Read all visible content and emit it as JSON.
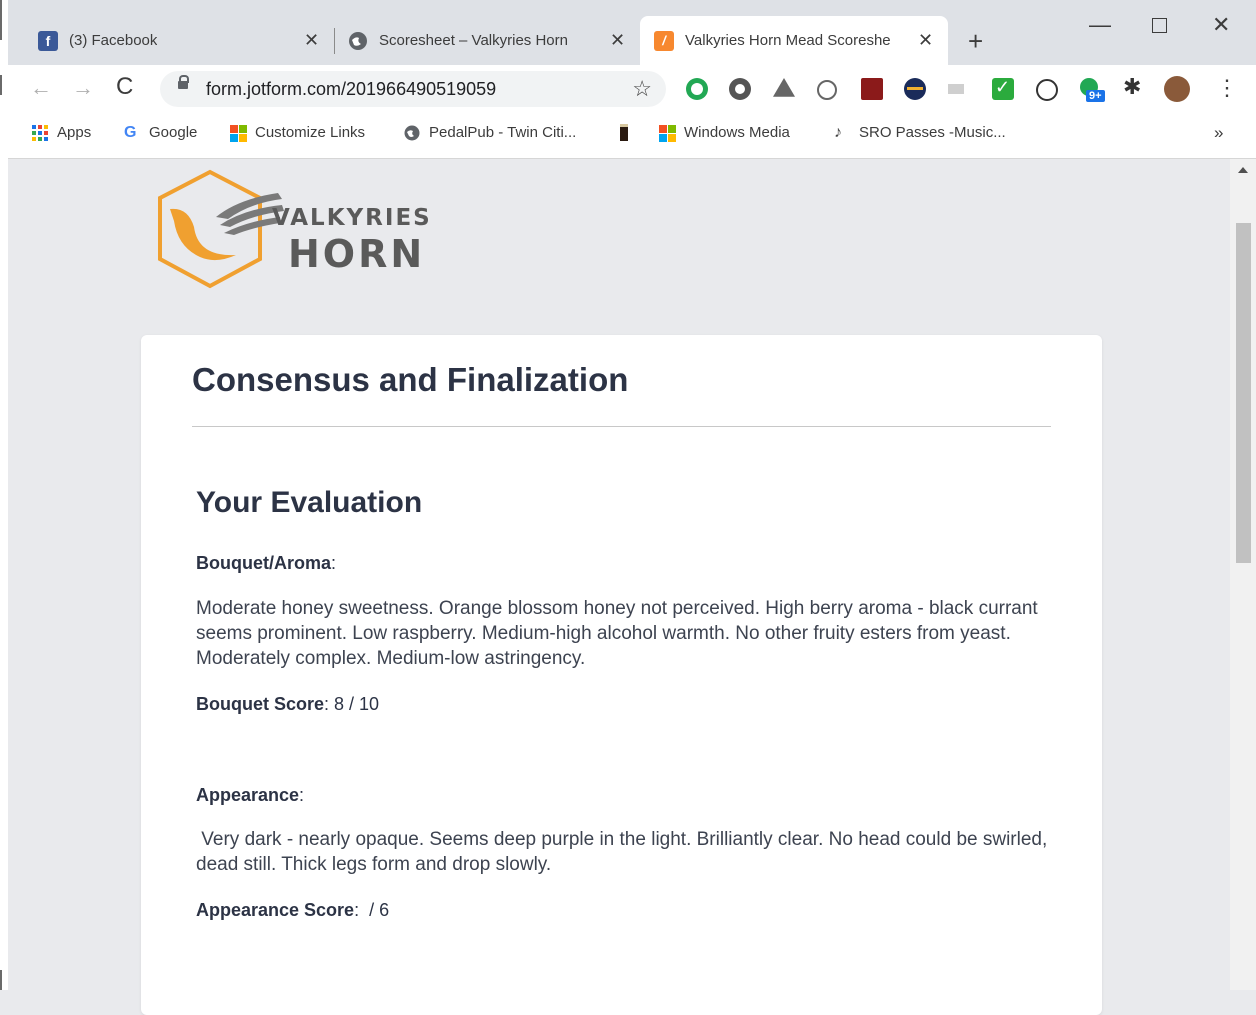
{
  "tabs": [
    {
      "title": "(3) Facebook"
    },
    {
      "title": "Scoresheet – Valkyries Horn"
    },
    {
      "title": "Valkyries Horn Mead Scoreshe"
    }
  ],
  "toolbar": {
    "url": "form.jotform.com/201966490519059",
    "extension_badge": "9+"
  },
  "bookmarks": [
    {
      "label": "Apps"
    },
    {
      "label": "Google"
    },
    {
      "label": "Customize Links"
    },
    {
      "label": "PedalPub - Twin Citi..."
    },
    {
      "label": ""
    },
    {
      "label": "Windows Media"
    },
    {
      "label": "SRO Passes -Music..."
    }
  ],
  "logo": {
    "line1": "VALKYRIES",
    "line2": "HORN"
  },
  "form": {
    "title": "Consensus and Finalization",
    "section": "Your Evaluation",
    "bouquet_label": "Bouquet/Aroma",
    "bouquet_text": "Moderate honey sweetness. Orange blossom honey not perceived. High berry aroma - black currant seems prominent. Low raspberry. Medium-high alcohol warmth. No other fruity esters from yeast. Moderately complex. Medium-low astringency.",
    "bouquet_score_label": "Bouquet Score",
    "bouquet_score_value": "8 / 10",
    "appearance_label": "Appearance",
    "appearance_text": " Very dark - nearly opaque. Seems deep purple in the light. Brilliantly clear. No head could be swirled, dead still. Thick legs form and drop slowly.",
    "appearance_score_label": "Appearance Score",
    "appearance_score_value": " / 6"
  },
  "colors": {
    "heading": "#2c3345",
    "logo_orange": "#f0a030",
    "logo_gray": "#5a5a5a"
  }
}
